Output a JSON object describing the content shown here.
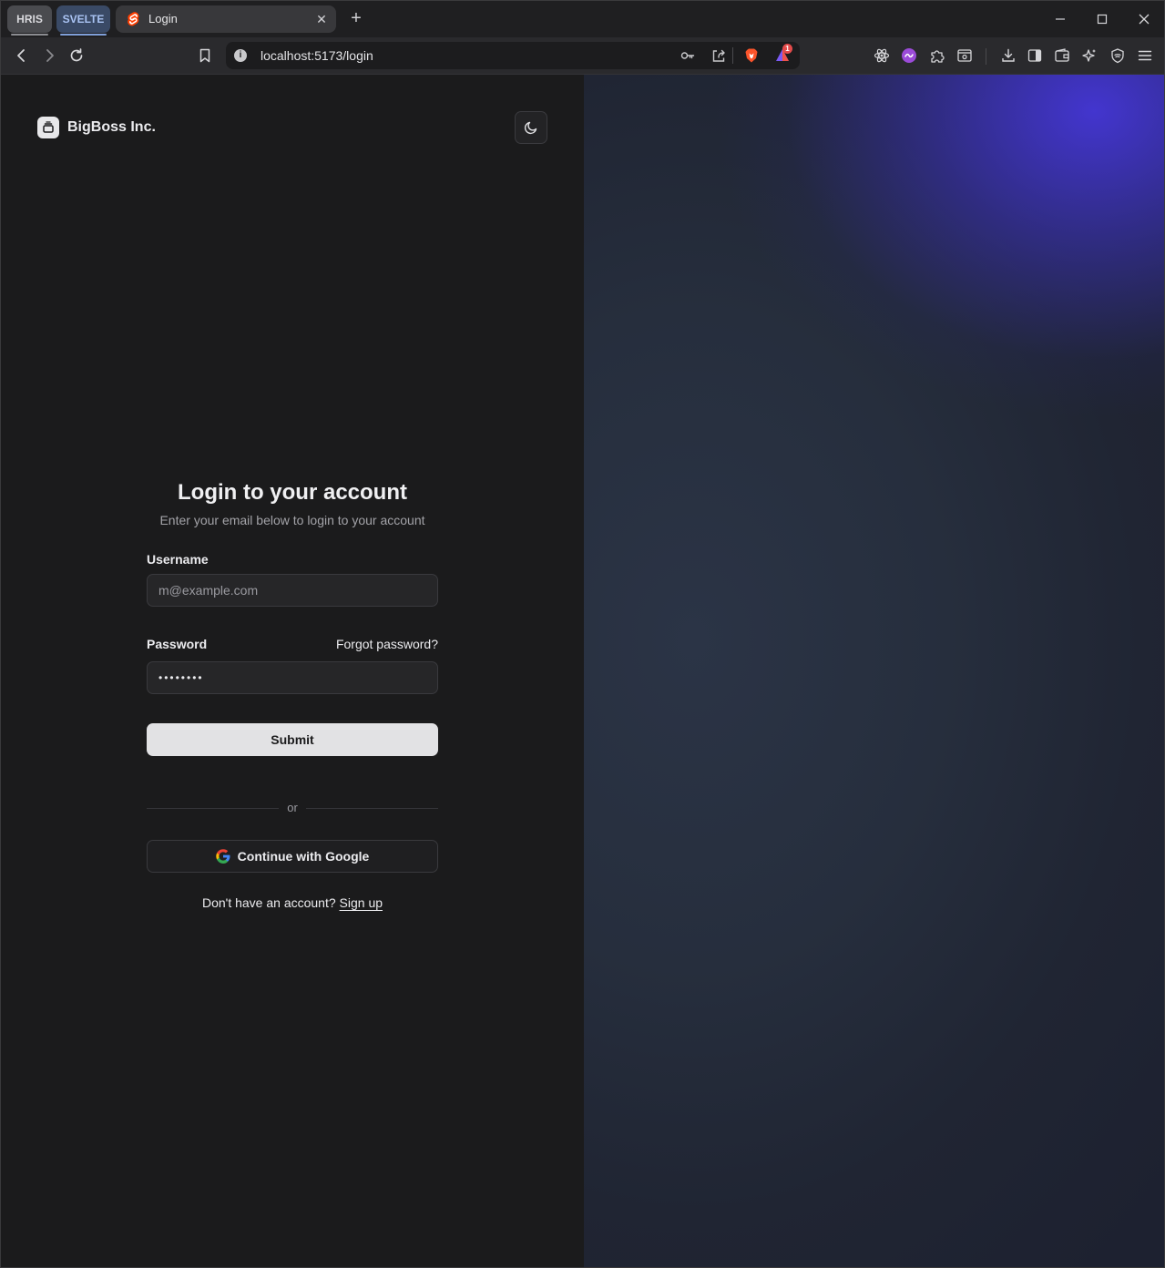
{
  "browser": {
    "tab_groups": [
      {
        "label": "HRIS"
      },
      {
        "label": "SVELTE"
      }
    ],
    "active_tab": {
      "title": "Login"
    },
    "url": "localhost:5173/login",
    "rewards_badge": "1"
  },
  "page": {
    "brand_name": "BigBoss Inc.",
    "title": "Login to your account",
    "subtitle": "Enter your email below to login to your account",
    "username_label": "Username",
    "username_placeholder": "m@example.com",
    "password_label": "Password",
    "forgot_password": "Forgot password?",
    "password_value": "••••••••",
    "submit_label": "Submit",
    "divider_text": "or",
    "google_label": "Continue with Google",
    "signup_prompt": "Don't have an account?",
    "signup_link": "Sign up"
  },
  "colors": {
    "accent_gradient": "#4a37dc",
    "background_left": "#1b1b1c",
    "background_right": "#262e3d"
  }
}
